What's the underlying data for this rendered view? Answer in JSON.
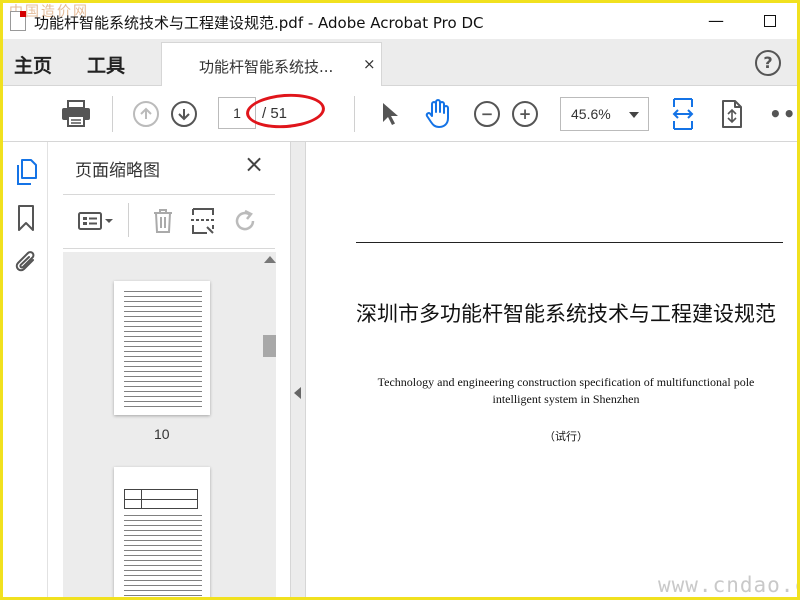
{
  "window": {
    "title": "功能杆智能系统技术与工程建设规范.pdf - Adobe Acrobat Pro DC",
    "minimize_label": "—",
    "watermark_top": "中国造价网"
  },
  "tabs": {
    "home": "主页",
    "tools": "工具",
    "document_tab": "功能杆智能系统技...",
    "document_tab_close": "×",
    "help": "?"
  },
  "toolbar": {
    "page_current": "1",
    "page_total": "/ 51",
    "zoom": "45.6%",
    "more": "•••",
    "icons": [
      "print-icon",
      "page-up-icon",
      "page-down-icon",
      "select-tool-icon",
      "hand-tool-icon",
      "zoom-out-icon",
      "zoom-in-icon",
      "zoom-dropdown",
      "fit-page-icon",
      "scroll-mode-icon",
      "more-icon"
    ]
  },
  "rail": {
    "icons": [
      "thumbnails-icon",
      "bookmark-icon",
      "attachment-icon"
    ],
    "accent": "#1473e6"
  },
  "thumbnail_pane": {
    "title": "页面缩略图",
    "close": "×",
    "tools": [
      "thumbnail-options-icon",
      "delete-icon",
      "extract-icon",
      "rotate-icon"
    ],
    "thumbnails": [
      {
        "label": "10"
      },
      {
        "label": ""
      }
    ]
  },
  "document": {
    "title": "深圳市多功能杆智能系统技术与工程建设规范",
    "subtitle": "Technology and engineering construction specification of multifunctional pole intelligent system in Shenzhen",
    "trial": "（试行）",
    "watermark": "www.cndao.com"
  },
  "colors": {
    "border": "#f1e11f",
    "annotation": "#e0151b",
    "accent": "#1473e6"
  }
}
